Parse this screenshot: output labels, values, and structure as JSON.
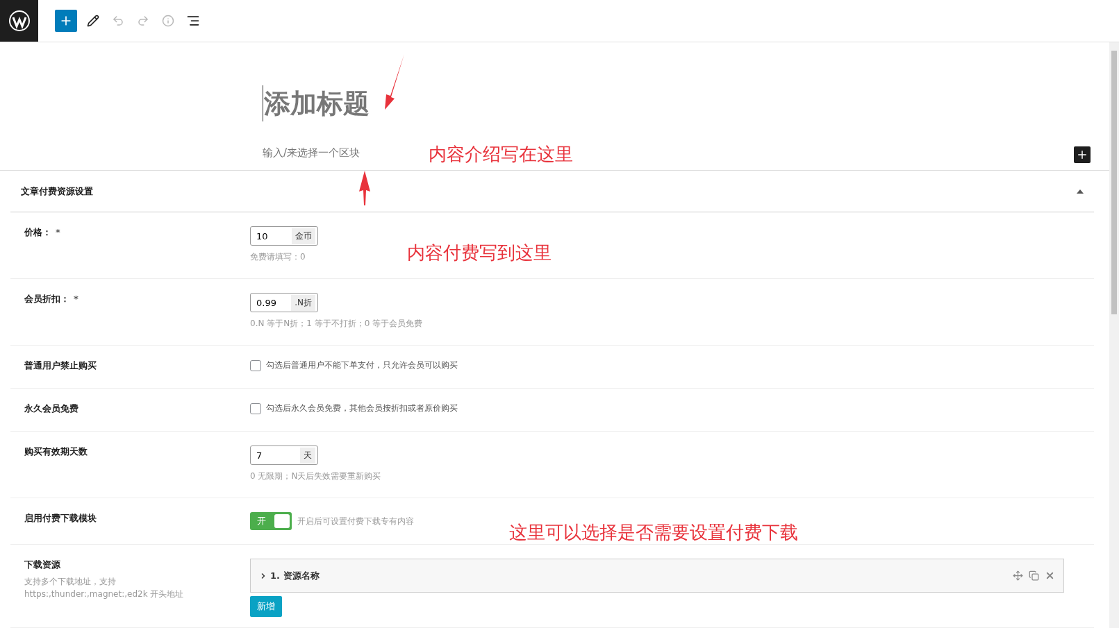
{
  "editor": {
    "title_placeholder": "添加标题",
    "block_placeholder": "输入/来选择一个区块"
  },
  "panel": {
    "title": "文章付费资源设置",
    "expanded": true,
    "rows": [
      {
        "kind": "input",
        "label": "价格：",
        "required_mark": "*",
        "value": "10",
        "unit": "金币",
        "hint": "免费请填写：0"
      },
      {
        "kind": "input",
        "label": "会员折扣：",
        "required_mark": "*",
        "value": "0.99",
        "unit": ".N折",
        "hint": "0.N 等于N折；1 等于不打折；0 等于会员免费"
      },
      {
        "kind": "checkbox",
        "label": "普通用户禁止购买",
        "checked": false,
        "text": "勾选后普通用户不能下单支付，只允许会员可以购买"
      },
      {
        "kind": "checkbox",
        "label": "永久会员免费",
        "checked": false,
        "text": "勾选后永久会员免费，其他会员按折扣或者原价购买"
      },
      {
        "kind": "input",
        "label": "购买有效期天数",
        "value": "7",
        "unit": "天",
        "hint": "0 无限期；N天后失效需要重新购买"
      },
      {
        "kind": "toggle",
        "label": "启用付费下载模块",
        "on": true,
        "switch_text": "开",
        "text": "开启后可设置付费下载专有内容"
      },
      {
        "kind": "repeater",
        "label": "下载资源",
        "description": "支持多个下载地址，支持 https:,thunder:,magnet:,ed2k 开头地址",
        "items": [
          {
            "title": "1. 资源名称",
            "expanded": false
          }
        ],
        "add_button": "新增"
      }
    ]
  },
  "annotations": [
    {
      "kind": "text",
      "text": "内容介绍写在这里"
    },
    {
      "kind": "text",
      "text": "内容付费写到这里"
    },
    {
      "kind": "text",
      "text": "这里可以选择是否需要设置付费下载"
    }
  ]
}
